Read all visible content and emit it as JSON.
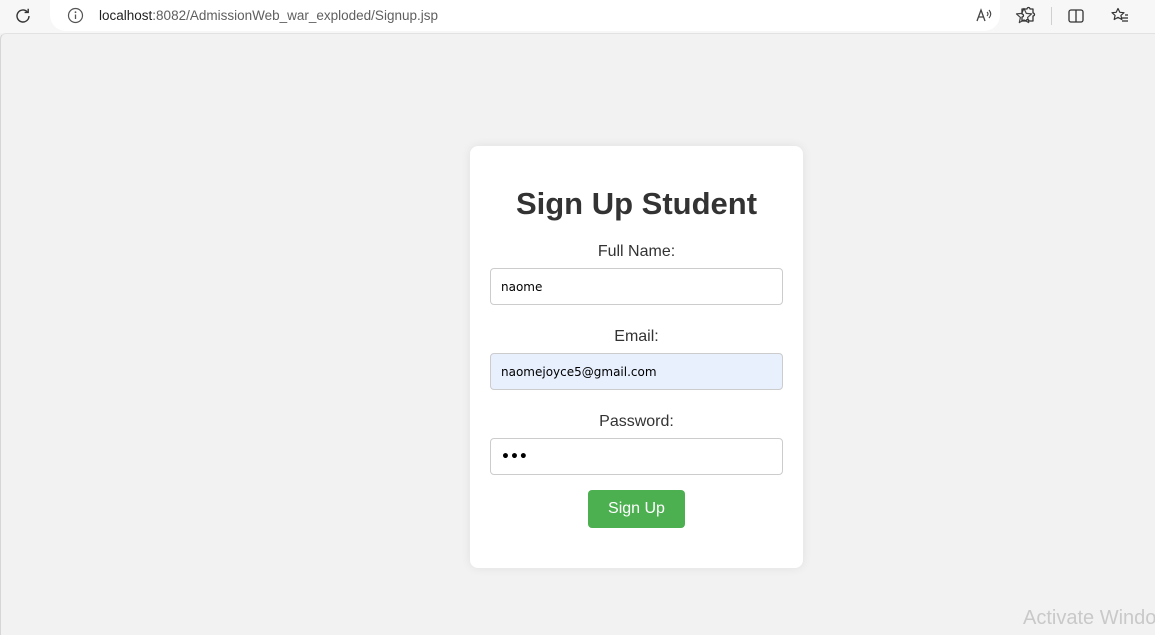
{
  "browser": {
    "url_host": "localhost",
    "url_path": ":8082/AdmissionWeb_war_exploded/Signup.jsp",
    "icons": {
      "reload": "reload-icon",
      "info": "info-icon",
      "read_aloud": "read-aloud-icon",
      "favorite": "favorite-star-icon",
      "extensions": "extensions-icon",
      "split_screen": "split-screen-icon",
      "favorites": "favorites-icon"
    }
  },
  "form": {
    "title": "Sign Up Student",
    "full_name_label": "Full Name:",
    "full_name_value": "naome",
    "email_label": "Email:",
    "email_value": "naomejoyce5@gmail.com",
    "password_label": "Password:",
    "password_value": "•••",
    "submit_label": "Sign Up"
  },
  "colors": {
    "button": "#4caf50",
    "autofill_bg": "#e8f0fe",
    "page_bg": "#f2f2f2"
  },
  "watermark": "Activate Windo"
}
